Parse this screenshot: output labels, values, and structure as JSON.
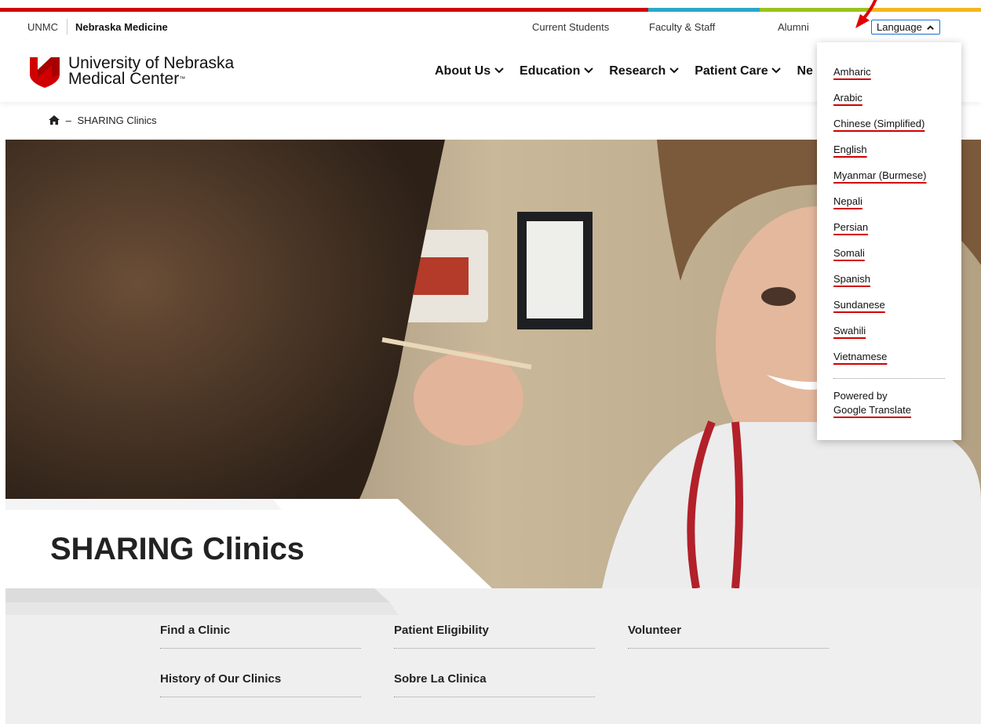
{
  "utility_nav": {
    "unmc": "UNMC",
    "nebraska_medicine": "Nebraska Medicine",
    "links": [
      "Current Students",
      "Faculty & Staff",
      "Alumni"
    ],
    "language_label": "Language"
  },
  "header": {
    "logo_line1": "University of Nebraska",
    "logo_line2": "Medical Center",
    "nav": [
      "About Us",
      "Education",
      "Research",
      "Patient Care",
      "Ne"
    ]
  },
  "breadcrumb": {
    "separator": "–",
    "current": "SHARING Clinics"
  },
  "hero": {
    "title": "SHARING Clinics"
  },
  "links": [
    "Find a Clinic",
    "Patient Eligibility",
    "Volunteer",
    "History of Our Clinics",
    "Sobre La Clinica"
  ],
  "language_menu": {
    "items": [
      "Amharic",
      "Arabic",
      "Chinese (Simplified)",
      "English",
      "Myanmar (Burmese)",
      "Nepali",
      "Persian",
      "Somali",
      "Spanish",
      "Sundanese",
      "Swahili",
      "Vietnamese"
    ],
    "powered_by": "Powered by",
    "google_translate": "Google Translate"
  },
  "colors": {
    "brand_red": "#d00000",
    "focus_blue": "#1b6fd6",
    "bar_blue": "#2aa7c9",
    "bar_green": "#9ac21d",
    "bar_yellow": "#f3b71f"
  },
  "icons": {
    "home": "home-icon",
    "chevron_down": "chevron-down-icon",
    "chevron_up": "chevron-up-icon",
    "annotation_arrow": "red-arrow-annotation"
  }
}
